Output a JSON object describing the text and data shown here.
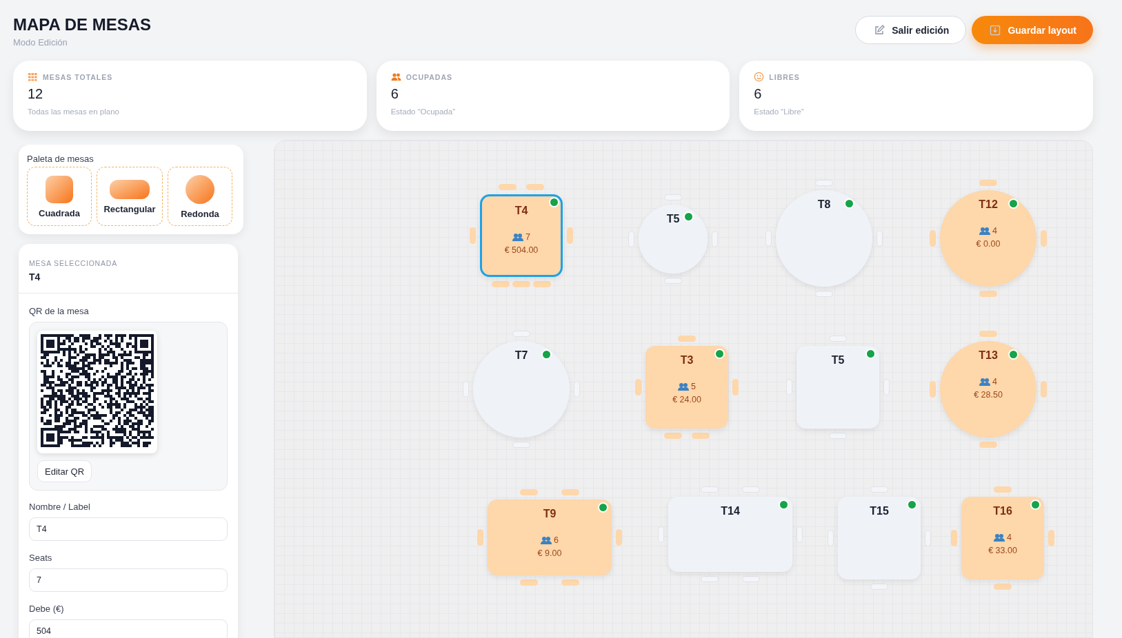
{
  "header": {
    "title": "MAPA DE MESAS",
    "subtitle": "Modo Edición",
    "buttons": [
      {
        "kind": "secondary",
        "label": "Salir edición"
      },
      {
        "kind": "primary",
        "label": "Guardar layout"
      }
    ]
  },
  "stats": [
    {
      "label": "MESAS TOTALES",
      "value": "12",
      "caption": "Todas las mesas en plano"
    },
    {
      "label": "OCUPADAS",
      "value": "6",
      "caption": "Estado “Ocupada”"
    },
    {
      "label": "LIBRES",
      "value": "6",
      "caption": "Estado “Libre”"
    }
  ],
  "palette": {
    "title": "Paleta de mesas",
    "items": [
      {
        "kind": "square",
        "label": "Cuadrada"
      },
      {
        "kind": "rect",
        "label": "Rectangular"
      },
      {
        "kind": "round",
        "label": "Redonda"
      }
    ]
  },
  "selected_table": {
    "heading": "MESA SELECCIONADA",
    "name": "T4",
    "qr_label": "QR de la mesa",
    "qr_button": "Editar QR",
    "fields": [
      {
        "label": "Nombre / Label",
        "value": "T4"
      },
      {
        "label": "Seats",
        "value": "7"
      },
      {
        "label": "Debe (€)",
        "value": "504"
      }
    ]
  },
  "tables": [
    {
      "label": "T4",
      "kind": "square",
      "occupied": true,
      "selected": true,
      "seats": "7",
      "amount": "€ 504.00"
    },
    {
      "label": "T5",
      "kind": "round",
      "occupied": false,
      "selected": false
    },
    {
      "label": "T8",
      "kind": "round",
      "occupied": false,
      "selected": false
    },
    {
      "label": "T12",
      "kind": "round",
      "occupied": true,
      "selected": false,
      "seats": "4",
      "amount": "€ 0.00"
    },
    {
      "label": "T7",
      "kind": "round",
      "occupied": false,
      "selected": false
    },
    {
      "label": "T3",
      "kind": "square",
      "occupied": true,
      "selected": false,
      "seats": "5",
      "amount": "€ 24.00"
    },
    {
      "label": "T5",
      "kind": "square",
      "occupied": false,
      "selected": false
    },
    {
      "label": "T13",
      "kind": "round",
      "occupied": true,
      "selected": false,
      "seats": "4",
      "amount": "€ 28.50"
    },
    {
      "label": "T9",
      "kind": "rect",
      "occupied": true,
      "selected": false,
      "seats": "6",
      "amount": "€ 9.00"
    },
    {
      "label": "T14",
      "kind": "rect",
      "occupied": false,
      "selected": false
    },
    {
      "label": "T15",
      "kind": "square",
      "occupied": false,
      "selected": false
    },
    {
      "label": "T16",
      "kind": "square",
      "occupied": true,
      "selected": false,
      "seats": "4",
      "amount": "€ 33.00"
    }
  ]
}
